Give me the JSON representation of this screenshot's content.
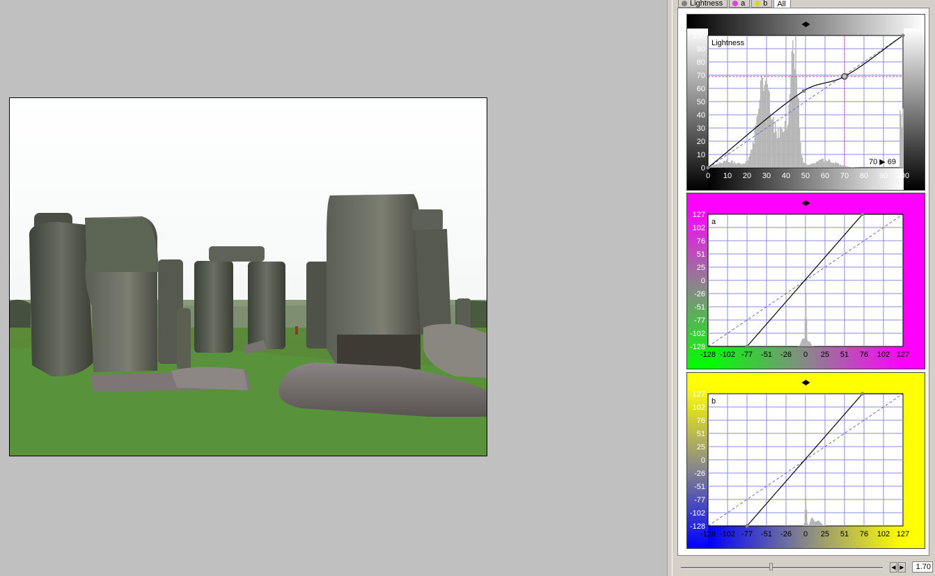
{
  "tabs": [
    {
      "label": "Lightness",
      "dot": "#808080",
      "active": false
    },
    {
      "label": "a",
      "dot": "#e040e0",
      "active": false
    },
    {
      "label": "b",
      "dot": "#d8d820",
      "active": false
    },
    {
      "label": "All",
      "dot": "",
      "active": true
    }
  ],
  "curves": [
    {
      "channel": "Lightness",
      "label": "Lightness",
      "frame_color": "gradient-gray",
      "min": 0,
      "max": 100,
      "ticks": [
        "0",
        "10",
        "20",
        "30",
        "40",
        "50",
        "60",
        "70",
        "80",
        "90",
        "100"
      ],
      "points": [
        [
          0,
          0
        ],
        [
          49,
          58
        ],
        [
          70,
          69
        ],
        [
          100,
          100
        ]
      ],
      "selected_point": [
        70,
        69
      ],
      "readout": "70 ▶ 69",
      "histogram": "lightness"
    },
    {
      "channel": "a",
      "label": "a",
      "frame_color": "#ff00ff",
      "min": -128,
      "max": 127,
      "ticks": [
        "-128",
        "-102",
        "-77",
        "-51",
        "-26",
        "0",
        "25",
        "51",
        "76",
        "102",
        "127"
      ],
      "points": [
        [
          -77,
          -128
        ],
        [
          74,
          127
        ]
      ],
      "histogram": "a"
    },
    {
      "channel": "b",
      "label": "b",
      "frame_color": "#ffff00",
      "min": -128,
      "max": 127,
      "ticks": [
        "-128",
        "-102",
        "-77",
        "-51",
        "-26",
        "0",
        "25",
        "51",
        "76",
        "102",
        "127"
      ],
      "points": [
        [
          -77,
          -128
        ],
        [
          74,
          127
        ]
      ],
      "histogram": "b"
    }
  ],
  "zoom": {
    "value": "1.70",
    "slider_fraction": 0.44
  }
}
